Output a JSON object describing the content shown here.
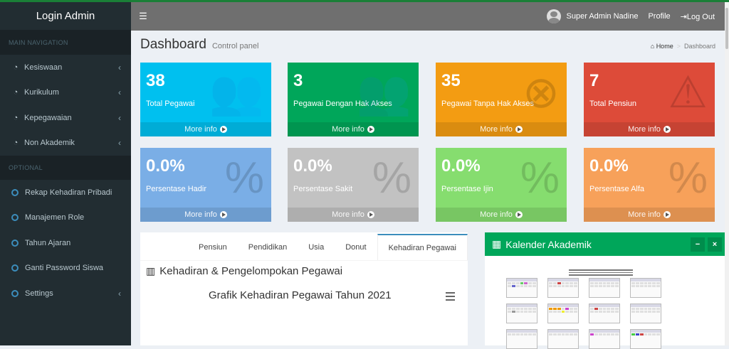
{
  "sidebar": {
    "brand": "Login Admin",
    "main_header": "MAIN NAVIGATION",
    "main_items": [
      {
        "label": "Kesiswaan"
      },
      {
        "label": "Kurikulum"
      },
      {
        "label": "Kepegawaian"
      },
      {
        "label": "Non Akademik"
      }
    ],
    "optional_header": "OPTIONAL",
    "optional_items": [
      {
        "label": "Rekap Kehadiran Pribadi"
      },
      {
        "label": "Manajemen Role"
      },
      {
        "label": "Tahun Ajaran"
      },
      {
        "label": "Ganti Password Siswa"
      },
      {
        "label": "Settings"
      }
    ]
  },
  "topbar": {
    "user": "Super Admin Nadine",
    "profile": "Profile",
    "logout": "Log Out"
  },
  "header": {
    "title": "Dashboard",
    "subtitle": "Control panel",
    "breadcrumb_home": "Home",
    "breadcrumb_current": "Dashboard"
  },
  "stats": [
    {
      "value": "38",
      "label": "Total Pegawai",
      "more": "More info",
      "color": "#00c0ef"
    },
    {
      "value": "3",
      "label": "Pegawai Dengan Hak Akses",
      "more": "More info",
      "color": "#00a65a"
    },
    {
      "value": "35",
      "label": "Pegawai Tanpa Hak Akses",
      "more": "More info",
      "color": "#f39c12"
    },
    {
      "value": "7",
      "label": "Total Pensiun",
      "more": "More info",
      "color": "#dd4b39"
    },
    {
      "value": "0.0%",
      "label": "Persentase Hadir",
      "more": "More info",
      "color": "#7aaee6"
    },
    {
      "value": "0.0%",
      "label": "Persentase Sakit",
      "more": "More info",
      "color": "#c2c2c2"
    },
    {
      "value": "0.0%",
      "label": "Persentase Ijin",
      "more": "More info",
      "color": "#86dd6f"
    },
    {
      "value": "0.0%",
      "label": "Persentase Alfa",
      "more": "More info",
      "color": "#f7a15a"
    }
  ],
  "tabs": [
    "Pensiun",
    "Pendidikan",
    "Usia",
    "Donut",
    "Kehadiran Pegawai"
  ],
  "panel": {
    "title": "Kehadiran & Pengelompokan Pegawai",
    "chart_title": "Grafik Kehadiran Pegawai Tahun 2021"
  },
  "calendar": {
    "title": "Kalender Akademik",
    "minimize": "−",
    "close": "×"
  }
}
